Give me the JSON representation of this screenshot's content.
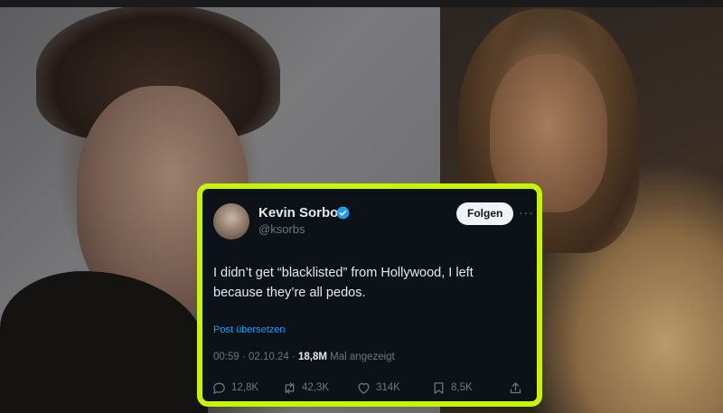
{
  "tweet": {
    "author_name": "Kevin Sorbo",
    "handle": "@ksorbs",
    "follow_label": "Folgen",
    "more_label": "···",
    "text_line1": "I didn’t get “blacklisted” from Hollywood, I left",
    "text_line2": "because they’re all pedos.",
    "translate_label": "Post übersetzen",
    "meta_prefix": "00:59 · 02.10.24 · ",
    "views_count": "18,8M",
    "views_label": " Mal angezeigt",
    "replies": "12,8K",
    "reposts": "42,3K",
    "likes": "314K",
    "bookmarks": "8,5K"
  },
  "colors": {
    "highlight_border": "#c7f500",
    "card_background": "#0c1217",
    "link": "#1d9bf0",
    "verified": "#1d9bf0"
  },
  "icons": [
    "verified-badge-icon",
    "more-icon",
    "reply-icon",
    "repost-icon",
    "like-icon",
    "bookmark-icon",
    "share-icon"
  ]
}
